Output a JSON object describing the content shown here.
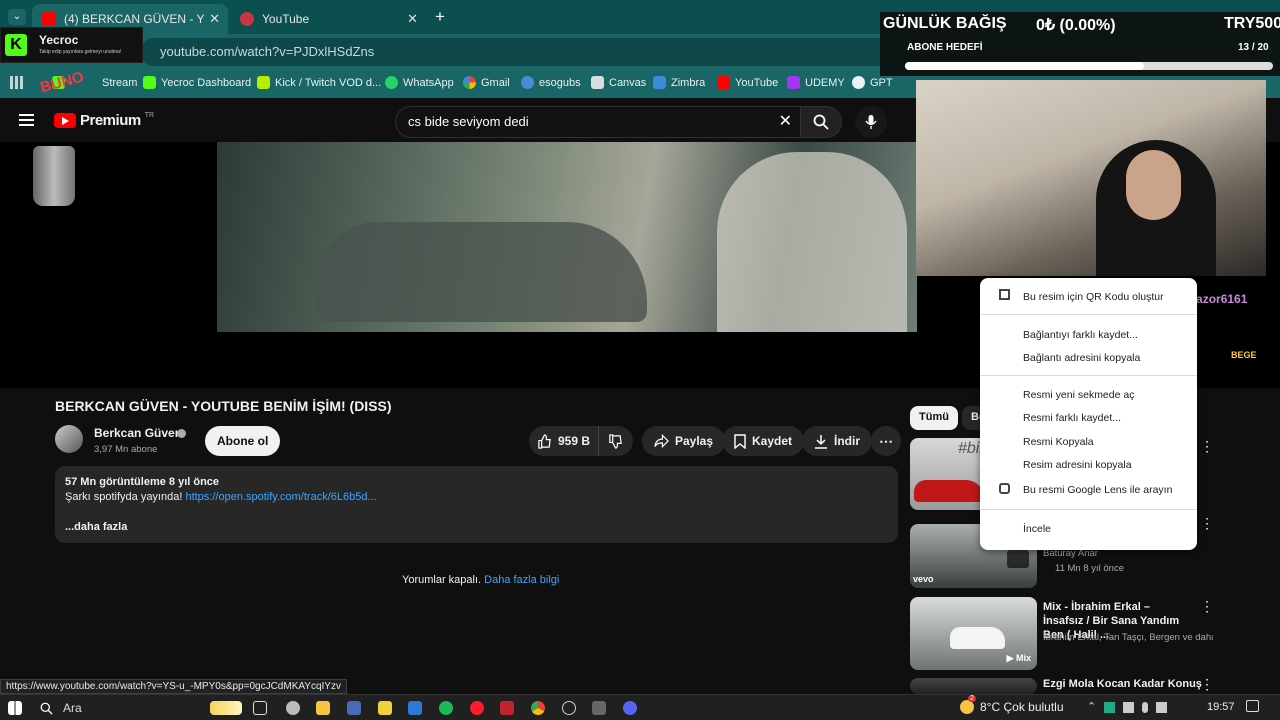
{
  "tabs": [
    {
      "label": "(4) BERKCAN GÜVEN - YOUTUB",
      "active": true
    },
    {
      "label": "YouTube",
      "active": false
    }
  ],
  "address": "youtube.com/watch?v=PJDxlHSdZns",
  "bookmarks": [
    "Stream",
    "Yecroc  Dashboard",
    "Kick / Twitch VOD d...",
    "WhatsApp",
    "Gmail",
    "esogubs",
    "Canvas",
    "Zimbra",
    "YouTube",
    "UDEMY",
    "GPT"
  ],
  "notification": {
    "title": "Yecroc",
    "subtitle": "Takip edip yayınlara gelmeyi unutma!"
  },
  "overlay": {
    "donation_label": "GÜNLÜK BAĞIŞ",
    "donation_value": "0₺ (0.00%)",
    "donation_goal": "TRY500",
    "sub_label": "ABONE HEDEFİ",
    "sub_count": "13 / 20",
    "sub_progress": 0.65,
    "recipient": "Son alıcı: insanazor6161",
    "bege": "BEGE",
    "logo_text": "BUNO"
  },
  "youtube": {
    "brand": "Premium",
    "region": "TR",
    "search_value": "cs bide seviyom dedi",
    "title": "BERKCAN GÜVEN - YOUTUBE BENİM İŞİM! (DISS)",
    "channel": "Berkcan Güven",
    "subscribers": "3,97 Mn abone",
    "subscribe_label": "Abone ol",
    "likes": "959 B",
    "share": "Paylaş",
    "save": "Kaydet",
    "download": "İndir",
    "views": "57 Mn görüntüleme  8 yıl önce",
    "desc_prefix": "Şarkı spotifyda yayında! ",
    "desc_link": "https://open.spotify.com/track/6L6b5d...",
    "more": "...daha fazla",
    "comments_off": "Yorumlar kapalı. ",
    "comments_link": "Daha fazla bilgi",
    "chip_all": "Tümü",
    "chip_other": "Be"
  },
  "context_menu": [
    "Bu resim için QR Kodu oluştur",
    "Bağlantıyı farklı kaydet...",
    "Bağlantı adresini kopyala",
    "Resmi yeni sekmede aç",
    "Resmi farklı kaydet...",
    "Resmi Kopyala",
    "Resim adresini kopyala",
    "Bu resmi Google Lens ile arayın",
    "İncele"
  ],
  "sidebar": [
    {
      "title": "",
      "meta1": "",
      "meta2": "",
      "badge": ""
    },
    {
      "title": "",
      "meta1": "Baturay Anar",
      "meta2": "11 Mn  8 yıl önce",
      "badge": "vevo"
    },
    {
      "title": "Mix - İbrahim Erkal – İnsafsız / Bir Sana Yandım Ben ( Halil ...",
      "meta1": "İbrahim Erkal, Tan Taşçı, Bergen ve daha ...",
      "meta2": "",
      "badge": "Mix"
    },
    {
      "title": "Ezgi Mola Kocan Kadar Konuş",
      "meta1": "",
      "meta2": "",
      "badge": ""
    }
  ],
  "thumb_text": "#biz",
  "status_url": "https://www.youtube.com/watch?v=YS-u_-MPY0s&pp=0gcJCdMKAYcqIYzv",
  "taskbar": {
    "search": "Ara",
    "weather": "8°C  Çok bulutlu",
    "time": "19:57",
    "badge": "2"
  }
}
